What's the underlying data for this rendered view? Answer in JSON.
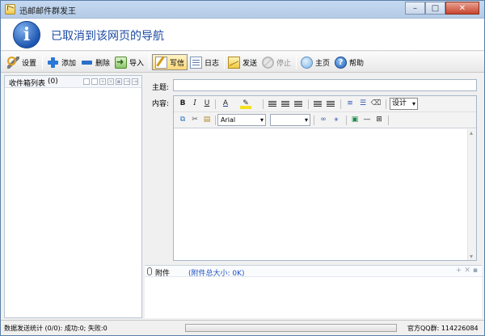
{
  "window": {
    "title": "迅邮邮件群发王"
  },
  "banner": {
    "message": "已取消到该网页的导航"
  },
  "toolbar": {
    "settings": "设置",
    "add": "添加",
    "delete": "删除",
    "import": "导入",
    "write": "写信",
    "log": "日志",
    "send": "发送",
    "stop": "停止",
    "home": "主页",
    "help": "帮助",
    "help_glyph": "?"
  },
  "mailbox_list": {
    "title": "收件箱列表",
    "count": "(0)"
  },
  "compose": {
    "subject_label": "主题:",
    "subject_value": "",
    "content_label": "内容:",
    "format_buttons": {
      "bold": "B",
      "italic": "I",
      "underline": "U"
    },
    "view_mode": "设计",
    "font": "Arial",
    "font_size": ""
  },
  "attachment": {
    "label": "附件",
    "total_size": "(附件总大小: 0K)"
  },
  "status": {
    "stats": "数据发送统计 (0/0): 成功:0; 失败:0",
    "progress": 0,
    "qq_group": "官方QQ群: 114226084"
  }
}
